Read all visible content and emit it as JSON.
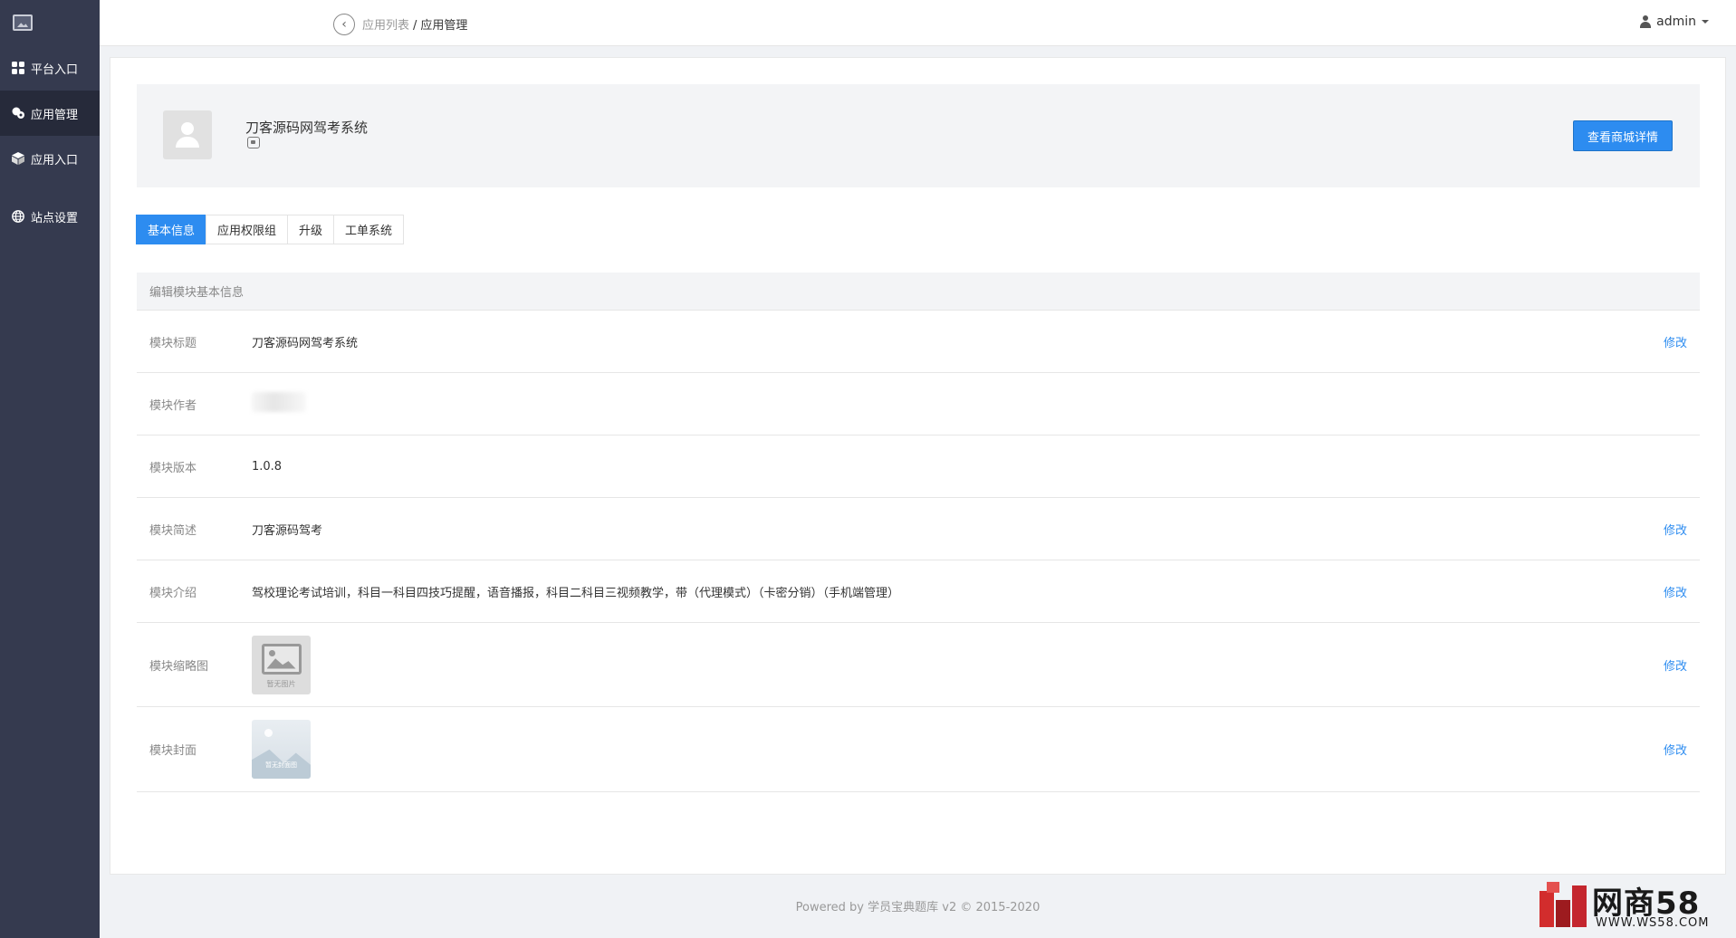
{
  "sidebar": {
    "items": [
      {
        "label": "平台入口",
        "icon": "grid-icon"
      },
      {
        "label": "应用管理",
        "icon": "cubes-icon",
        "active": true
      },
      {
        "label": "应用入口",
        "icon": "cube-icon"
      },
      {
        "label": "站点设置",
        "icon": "globe-icon"
      }
    ]
  },
  "topbar": {
    "breadcrumb_link": "应用列表",
    "breadcrumb_sep": "/",
    "breadcrumb_current": "应用管理",
    "user_name": "admin"
  },
  "app_header": {
    "title": "刀客源码网驾考系统",
    "shop_button": "查看商城详情"
  },
  "tabs": [
    "基本信息",
    "应用权限组",
    "升级",
    "工单系统"
  ],
  "panel": {
    "title": "编辑模块基本信息",
    "edit_label": "修改",
    "rows": {
      "title": {
        "label": "模块标题",
        "value": "刀客源码网驾考系统"
      },
      "author": {
        "label": "模块作者",
        "value": ""
      },
      "version": {
        "label": "模块版本",
        "value": "1.0.8"
      },
      "summary": {
        "label": "模块简述",
        "value": "刀客源码驾考"
      },
      "intro": {
        "label": "模块介绍",
        "value": "驾校理论考试培训，科目一科目四技巧提醒，语音播报，科目二科目三视频教学，带（代理模式）（卡密分销）（手机端管理）"
      },
      "thumb": {
        "label": "模块缩略图",
        "placeholder_text": "暂无图片"
      },
      "cover": {
        "label": "模块封面",
        "placeholder_text": "暂无封面图"
      }
    }
  },
  "footer": {
    "text": "Powered by 学员宝典题库 v2 © 2015-2020"
  },
  "watermark": {
    "brand": "网商58",
    "url": "WWW.WS58.COM"
  },
  "colors": {
    "sidebar_bg": "#353a4f",
    "primary": "#2d8cf0"
  }
}
